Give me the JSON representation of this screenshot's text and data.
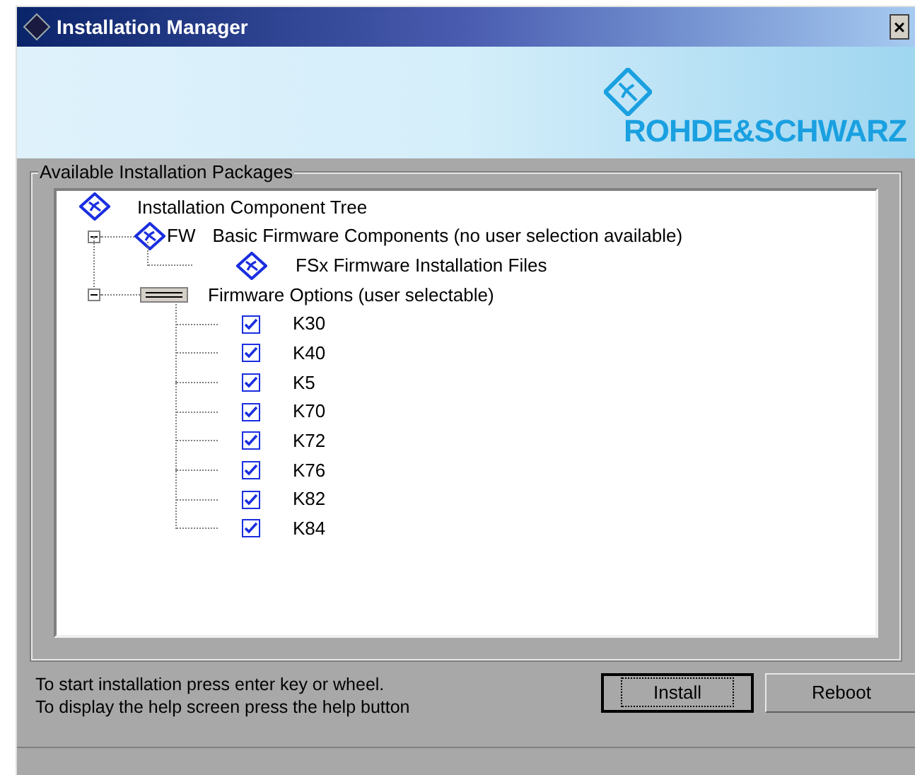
{
  "window": {
    "title": "Installation Manager",
    "close": "×"
  },
  "banner": {
    "brand": "ROHDE&SCHWARZ"
  },
  "group": {
    "title": "Available Installation Packages"
  },
  "tree": {
    "label": "Installation Component Tree",
    "kind": "package",
    "children": [
      {
        "prefix": "FW",
        "label": "Basic Firmware Components (no user selection available)",
        "kind": "package",
        "expanded": true,
        "children": [
          {
            "label": "FSx Firmware Installation Files",
            "kind": "package"
          }
        ]
      },
      {
        "label": "Firmware Options (user selectable)",
        "kind": "options",
        "expanded": true,
        "children": [
          {
            "label": "K30",
            "kind": "option",
            "checked": true
          },
          {
            "label": "K40",
            "kind": "option",
            "checked": true
          },
          {
            "label": "K5",
            "kind": "option",
            "checked": true
          },
          {
            "label": "K70",
            "kind": "option",
            "checked": true
          },
          {
            "label": "K72",
            "kind": "option",
            "checked": true
          },
          {
            "label": "K76",
            "kind": "option",
            "checked": true
          },
          {
            "label": "K82",
            "kind": "option",
            "checked": true
          },
          {
            "label": "K84",
            "kind": "option",
            "checked": true
          }
        ]
      }
    ]
  },
  "hints": [
    "To start installation press enter key or wheel.",
    "To display the help screen press the help button"
  ],
  "buttons": [
    {
      "label": "Install",
      "focused": true
    },
    {
      "label": "Reboot",
      "focused": false
    }
  ]
}
